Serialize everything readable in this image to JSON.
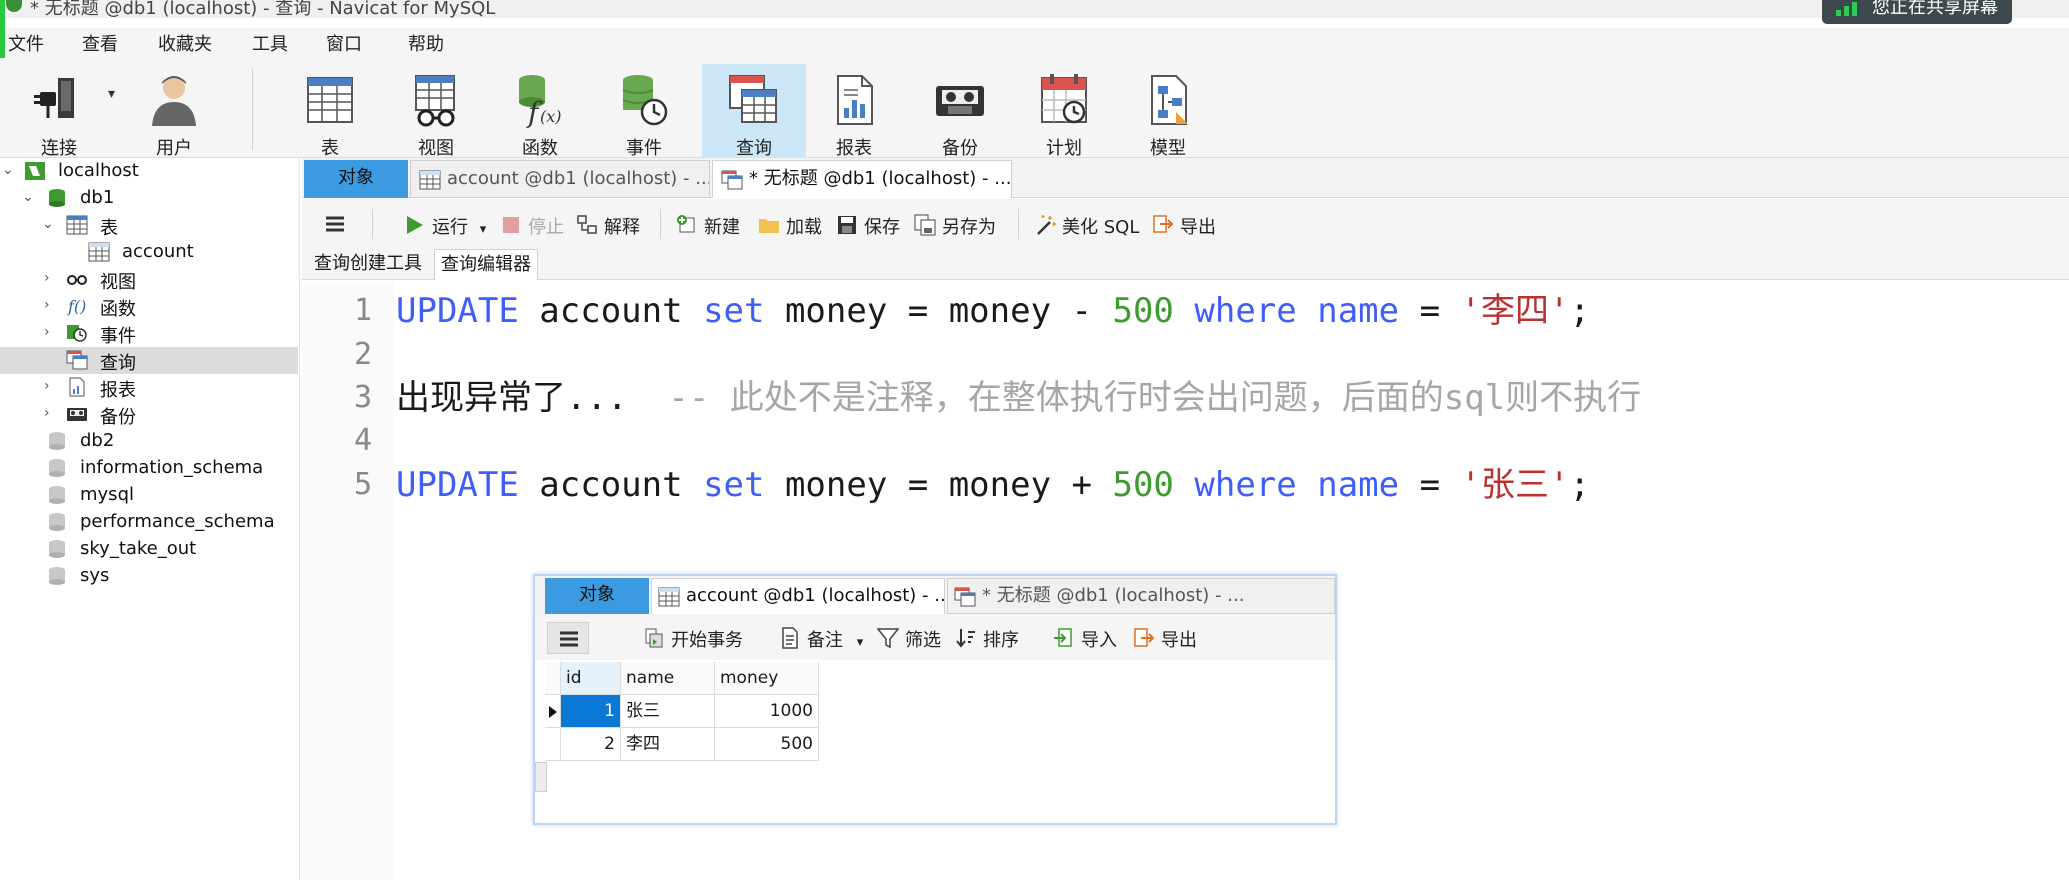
{
  "window": {
    "title": "* 无标题 @db1 (localhost) - 查询 - Navicat for MySQL",
    "share_badge": "您正在共享屏幕"
  },
  "menubar": [
    "文件",
    "查看",
    "收藏夹",
    "工具",
    "窗口",
    "帮助"
  ],
  "toolbar": {
    "connect": "连接",
    "user": "用户",
    "table": "表",
    "view": "视图",
    "function": "函数",
    "event": "事件",
    "query": "查询",
    "report": "报表",
    "backup": "备份",
    "schedule": "计划",
    "model": "模型",
    "active": "query"
  },
  "tree": {
    "localhost": "localhost",
    "db1": "db1",
    "tables": "表",
    "account": "account",
    "views": "视图",
    "functions": "函数",
    "events": "事件",
    "queries": "查询",
    "reports": "报表",
    "backups": "备份",
    "db2": "db2",
    "information_schema": "information_schema",
    "mysql": "mysql",
    "performance_schema": "performance_schema",
    "sky_take_out": "sky_take_out",
    "sys": "sys"
  },
  "tabs": {
    "objects": "对象",
    "account_tab": "account @db1 (localhost) - ...",
    "query_tab": "* 无标题 @db1 (localhost) - ..."
  },
  "query_toolbar": {
    "run": "运行",
    "stop": "停止",
    "explain": "解释",
    "new": "新建",
    "load": "加载",
    "save": "保存",
    "save_as": "另存为",
    "beautify": "美化 SQL",
    "export": "导出"
  },
  "subtabs": {
    "builder": "查询创建工具",
    "editor": "查询编辑器"
  },
  "editor": {
    "line_numbers": [
      "1",
      "2",
      "3",
      "4",
      "5"
    ],
    "line1": {
      "kw1": "UPDATE",
      "t1": " account ",
      "kw2": "set",
      "t2": " money = money - ",
      "num": "500",
      "sp": " ",
      "kw3": "where",
      "sp2": " ",
      "kw4": "name",
      "t3": " = ",
      "str": "'李四'",
      "end": ";"
    },
    "line3": {
      "text": "出现异常了...",
      "comment": "  -- 此处不是注释，在整体执行时会出问题，后面的sql则不执行"
    },
    "line5": {
      "kw1": "UPDATE",
      "t1": " account ",
      "kw2": "set",
      "t2": " money = money + ",
      "num": "500",
      "sp": " ",
      "kw3": "where",
      "sp2": " ",
      "kw4": "name",
      "t3": " = ",
      "str": "'张三'",
      "end": ";"
    }
  },
  "popup": {
    "tabs": {
      "objects": "对象",
      "account_tab": "account @db1 (localhost) - ...",
      "query_tab": "* 无标题 @db1 (localhost) - ..."
    },
    "toolbar": {
      "begin_transaction": "开始事务",
      "memo": "备注",
      "filter": "筛选",
      "sort": "排序",
      "import": "导入",
      "export": "导出"
    },
    "grid": {
      "columns": [
        "id",
        "name",
        "money"
      ],
      "rows": [
        [
          "1",
          "张三",
          "1000"
        ],
        [
          "2",
          "李四",
          "500"
        ]
      ]
    }
  },
  "colors": {
    "accent_blue": "#3c9be0",
    "keyword": "#3e5ef5",
    "number": "#3d9b2f",
    "string": "#b83232",
    "comment": "#a6a6a6",
    "selected_row": "#0a78d7"
  }
}
